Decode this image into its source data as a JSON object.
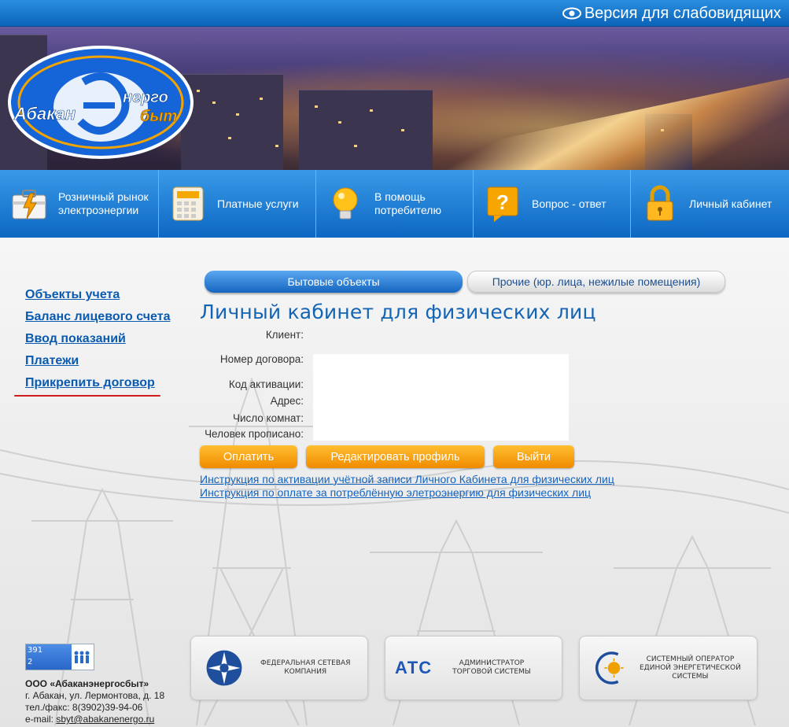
{
  "top_bar": {
    "vision_link": "Версия для слабовидящих"
  },
  "logo": {
    "left_text": "Абакан",
    "right_text_top": "нерго",
    "right_text_bottom": "быт"
  },
  "nav": [
    {
      "label": "Розничный рынок электроэнергии",
      "icon": "power-case-icon"
    },
    {
      "label": "Платные услуги",
      "icon": "calculator-icon"
    },
    {
      "label": "В помощь потребителю",
      "icon": "lightbulb-icon"
    },
    {
      "label": "Вопрос - ответ",
      "icon": "question-icon"
    },
    {
      "label": "Личный кабинет",
      "icon": "lock-icon"
    }
  ],
  "sidebar": [
    {
      "label": "Объекты учета"
    },
    {
      "label": "Баланс лицевого счета"
    },
    {
      "label": "Ввод показаний"
    },
    {
      "label": "Платежи"
    },
    {
      "label": "Прикрепить договор"
    }
  ],
  "tabs": [
    {
      "label": "Бытовые объекты",
      "active": true
    },
    {
      "label": "Прочие (юр. лица, нежилые помещения)",
      "active": false
    }
  ],
  "page_title": "Личный кабинет для физических лиц",
  "fields": [
    {
      "label": "Клиент:"
    },
    {
      "label": "Номер договора:"
    },
    {
      "label": "Код активации:"
    },
    {
      "label": "Адрес:"
    },
    {
      "label": "Число комнат:"
    },
    {
      "label": "Человек прописано:"
    }
  ],
  "buttons": {
    "pay": "Оплатить",
    "edit_profile": "Редактировать профиль",
    "logout": "Выйти"
  },
  "instructions": [
    "Инструкция по активации учётной записи Личного Кабинета для физических лиц",
    "Инструкция по оплате за потреблённую элетроэнергию для физических лиц"
  ],
  "counter": {
    "line1": "391",
    "line2": "2"
  },
  "footer": {
    "org_name": "ООО «Абаканэнергосбыт»",
    "address": "г. Абакан, ул. Лермонтова, д. 18",
    "phone": "тел./факс: 8(3902)39-94-06",
    "email_label": "e-mail:",
    "email": "sbyt@abakanenergo.ru"
  },
  "partners": [
    {
      "logo_text": "",
      "text_line1": "ФЕДЕРАЛЬНАЯ СЕТЕВАЯ",
      "text_line2": "КОМПАНИЯ",
      "text_line3": ""
    },
    {
      "logo_text": "АТС",
      "text_line1": "АДМИНИСТРАТОР",
      "text_line2": "ТОРГОВОЙ СИСТЕМЫ",
      "text_line3": ""
    },
    {
      "logo_text": "",
      "text_line1": "СИСТЕМНЫЙ ОПЕРАТОР",
      "text_line2": "ЕДИНОЙ ЭНЕРГЕТИЧЕСКОЙ",
      "text_line3": "СИСТЕМЫ"
    }
  ],
  "colors": {
    "brand_blue": "#0b64b8",
    "link_blue": "#0a5ab0",
    "title_blue": "#1464b4",
    "button_orange": "#f08a00",
    "underline_red": "#d01c1c"
  }
}
